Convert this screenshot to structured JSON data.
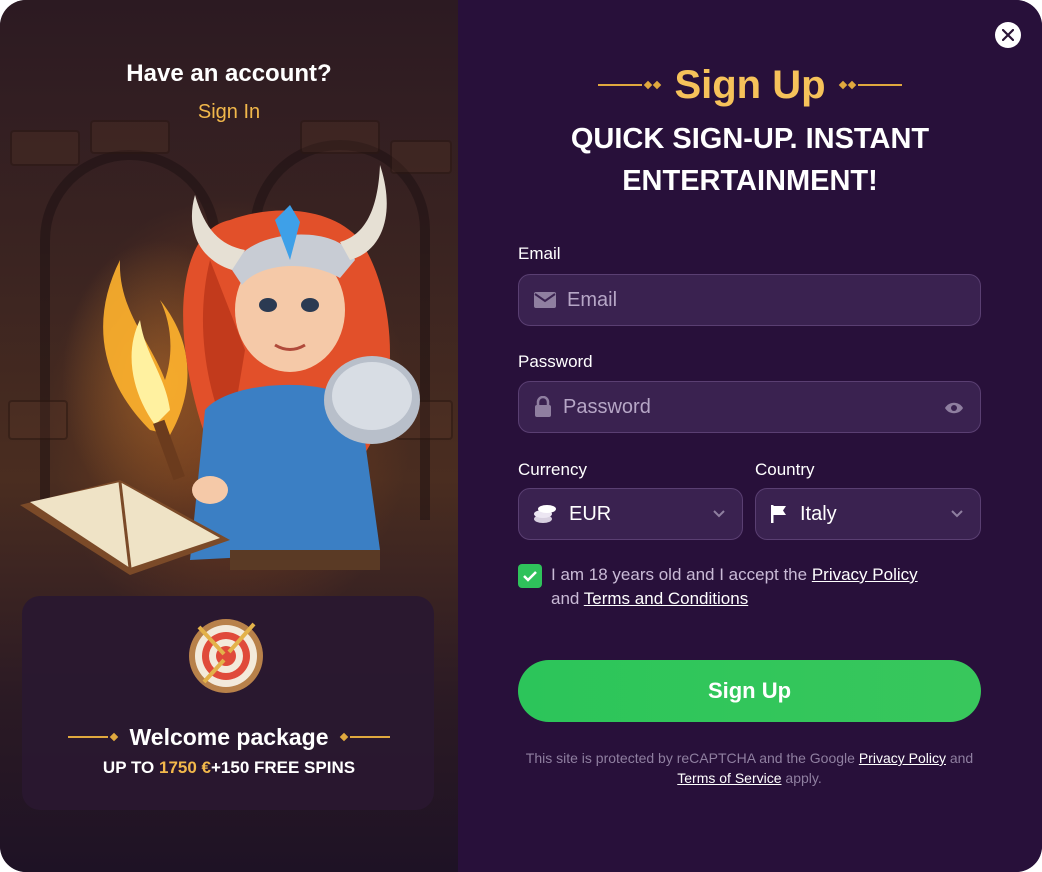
{
  "left_panel": {
    "heading": "Have an account?",
    "sign_in_link": "Sign In",
    "promo": {
      "title": "Welcome package",
      "offer_prefix": "UP TO ",
      "offer_amount": "1750 €",
      "offer_suffix": "+150 FREE SPINS"
    }
  },
  "form": {
    "title": "Sign Up",
    "subtitle_line1": "QUICK SIGN-UP. INSTANT",
    "subtitle_line2": "ENTERTAINMENT!",
    "email": {
      "label": "Email",
      "placeholder": "Email"
    },
    "password": {
      "label": "Password",
      "placeholder": "Password"
    },
    "currency": {
      "label": "Currency",
      "value": "EUR"
    },
    "country": {
      "label": "Country",
      "value": "Italy"
    },
    "consent": {
      "checked": true,
      "text_before": "I am 18 years old and I accept the ",
      "privacy_link": "Privacy Policy",
      "text_middle": " and ",
      "terms_link": "Terms and Conditions"
    },
    "submit_label": "Sign Up",
    "recaptcha": {
      "text_before": "This site is protected by reCAPTCHA and the Google ",
      "privacy_link": "Privacy Policy",
      "text_middle": " and ",
      "terms_link": "Terms of Service",
      "text_after": " apply."
    }
  },
  "icons": {
    "close": "close-icon",
    "email": "envelope-icon",
    "password": "lock-icon",
    "show_password": "eye-icon",
    "currency": "coins-icon",
    "country": "flag-icon",
    "dropdown": "chevron-down-icon",
    "checkbox": "checkmark-icon"
  },
  "colors": {
    "accent_gold": "#f6c25a",
    "button_green": "#2fc25b",
    "panel_bg": "#28103a",
    "field_bg": "#3a2250"
  }
}
